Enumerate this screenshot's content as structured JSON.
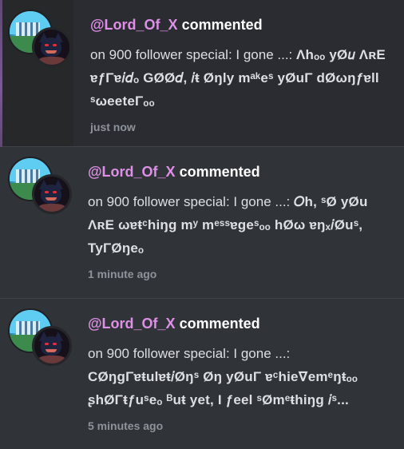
{
  "notifications": [
    {
      "username": "@Lord_Of_X",
      "action": "commented",
      "prefix": "on 900 follower special: I gone ...:",
      "message": "Λhₒₒ yØ𝑢 ΛʀE ɐƒΓɐ𝑖𝑑ₒ GØØ𝑑, 𝑖ŧ Øŋly mᵃᵏeˢ yØuΓ dØωŋƒɐll ˢωeeteΓₒₒ",
      "time": "just now"
    },
    {
      "username": "@Lord_Of_X",
      "action": "commented",
      "prefix": "on 900 follower special: I gone ...:",
      "message": "𝑂h, ˢØ yØu ΛʀE ωɐŧᶜhiŋg mʸ mᵉˢˢɐgeˢₒₒ hØω ɐŋₓ𝑖Øuˢ, TyΓØŋeₒ",
      "time": "1 minute ago"
    },
    {
      "username": "@Lord_Of_X",
      "action": "commented",
      "prefix": "on 900 follower special: I gone ...:",
      "message": "CØŋgΓɐŧulɐŧ𝑖Øŋˢ Øŋ yØuΓ ɐᶜhie∇emᵉŋŧₒₒ ʂhØΓŧƒuˢeₒ ᴮuŧ yet, I ƒeel ˢØmᵉŧhiŋg 𝑖ˢ...",
      "time": "5 minutes ago"
    }
  ],
  "colors": {
    "username": "#de8fe6",
    "background": "#303338",
    "text": "#dcdfe3",
    "muted": "#8e939b"
  }
}
